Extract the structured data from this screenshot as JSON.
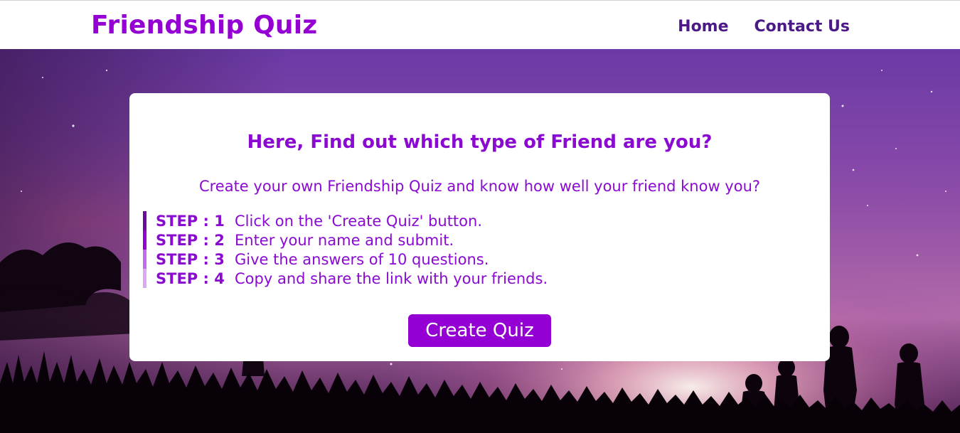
{
  "navbar": {
    "brand": "Friendship Quiz",
    "links": [
      {
        "label": "Home"
      },
      {
        "label": "Contact Us"
      }
    ]
  },
  "card": {
    "title": "Here, Find out which type of Friend are you?",
    "subtitle": "Create your own Friendship Quiz and know how well your friend know you?",
    "steps": [
      {
        "label": "STEP : 1",
        "text": "Click on the 'Create Quiz' button.",
        "bar_color": "#6a0a9e"
      },
      {
        "label": "STEP : 2",
        "text": "Enter your name and submit.",
        "bar_color": "#9400D3"
      },
      {
        "label": "STEP : 3",
        "text": "Give the answers of 10 questions.",
        "bar_color": "#c36be8"
      },
      {
        "label": "STEP : 4",
        "text": "Copy and share the link with your friends.",
        "bar_color": "#dca8f3"
      }
    ],
    "button_label": "Create Quiz"
  },
  "colors": {
    "brand": "#9400D3",
    "nav_link": "#4b1a86",
    "card_text": "#8a0ad1"
  }
}
